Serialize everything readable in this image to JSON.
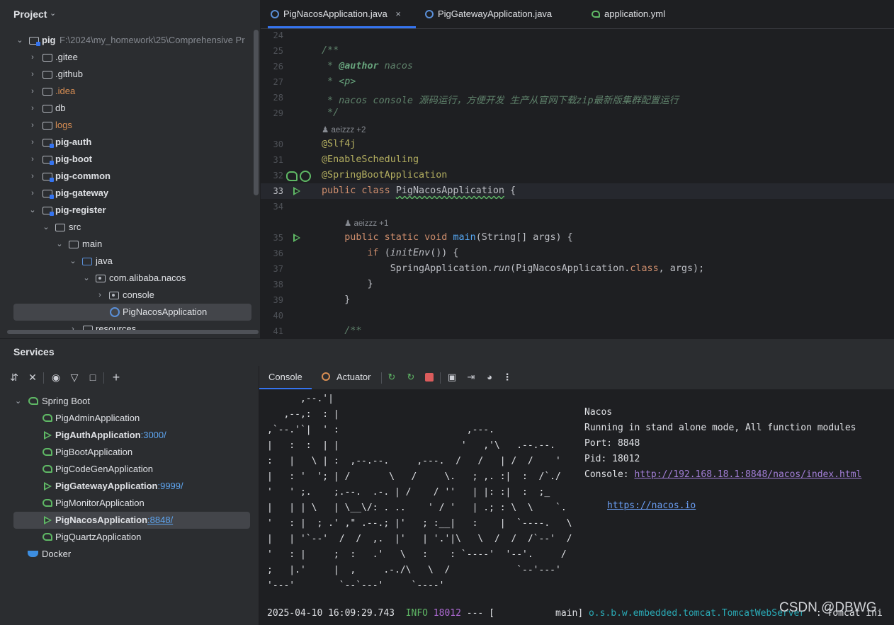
{
  "project_panel": {
    "title": "Project",
    "root": {
      "name": "pig",
      "path": "F:\\2024\\my_homework\\25\\Comprehensive Pr"
    },
    "items": [
      {
        "label": "pig",
        "type": "module",
        "bold": true
      },
      {
        "label": ".gitee",
        "type": "folder"
      },
      {
        "label": ".github",
        "type": "folder"
      },
      {
        "label": ".idea",
        "type": "folder",
        "color": "#d88e53"
      },
      {
        "label": "db",
        "type": "folder"
      },
      {
        "label": "logs",
        "type": "folder",
        "color": "#d88e53"
      },
      {
        "label": "pig-auth",
        "type": "module",
        "bold": true
      },
      {
        "label": "pig-boot",
        "type": "module",
        "bold": true
      },
      {
        "label": "pig-common",
        "type": "module",
        "bold": true
      },
      {
        "label": "pig-gateway",
        "type": "module",
        "bold": true
      },
      {
        "label": "pig-register",
        "type": "module",
        "bold": true
      },
      {
        "label": "src",
        "type": "folder"
      },
      {
        "label": "main",
        "type": "folder"
      },
      {
        "label": "java",
        "type": "folder"
      },
      {
        "label": "com.alibaba.nacos",
        "type": "package"
      },
      {
        "label": "console",
        "type": "package"
      },
      {
        "label": "PigNacosApplication",
        "type": "class"
      },
      {
        "label": "resources",
        "type": "folder"
      }
    ]
  },
  "editor": {
    "tabs": [
      {
        "label": "PigNacosApplication.java",
        "active": true,
        "close": "×"
      },
      {
        "label": "PigGatewayApplication.java",
        "active": false
      },
      {
        "label": "application.yml",
        "active": false
      }
    ],
    "line_numbers": [
      "24",
      "25",
      "26",
      "27",
      "28",
      "29",
      "30",
      "31",
      "32",
      "33",
      "34",
      "35",
      "36",
      "37",
      "38",
      "39",
      "40",
      "41"
    ],
    "hints": {
      "class_author": "aeizzz +2",
      "method_author": "aeizzz +1"
    },
    "code": {
      "l25": "/**",
      "l26_a": " * ",
      "l26_b": "@author",
      "l26_c": " nacos",
      "l27_a": " * ",
      "l27_b": "<p>",
      "l28": " * nacos console 源码运行，方便开发 生产从官网下载zip最新版集群配置运行",
      "l29": " */",
      "l30": "@Slf4j",
      "l31": "@EnableScheduling",
      "l32": "@SpringBootApplication",
      "l33_kw": "public class ",
      "l33_name": "PigNacosApplication",
      "l33_rest": " {",
      "l35_kw": "    public static void ",
      "l35_fn": "main",
      "l35_rest": "(String[] args) {",
      "l36_kw": "        if ",
      "l36_a": "(",
      "l36_it": "initEnv",
      "l36_b": "()) {",
      "l37_a": "            SpringApplication.",
      "l37_it": "run",
      "l37_b": "(PigNacosApplication.",
      "l37_kw": "class",
      "l37_c": ", args);",
      "l38": "        }",
      "l39": "    }",
      "l41": "    /**"
    }
  },
  "services": {
    "title": "Services",
    "tree": [
      {
        "label": "Spring Boot",
        "port": ""
      },
      {
        "label": "PigAdminApplication",
        "port": "",
        "running": false
      },
      {
        "label": "PigAuthApplication",
        "port": ":3000/",
        "running": true
      },
      {
        "label": "PigBootApplication",
        "port": "",
        "running": false
      },
      {
        "label": "PigCodeGenApplication",
        "port": "",
        "running": false
      },
      {
        "label": "PigGatewayApplication",
        "port": ":9999/",
        "running": true
      },
      {
        "label": "PigMonitorApplication",
        "port": "",
        "running": false
      },
      {
        "label": "PigNacosApplication",
        "port": ":8848/",
        "running": true,
        "selected": true
      },
      {
        "label": "PigQuartzApplication",
        "port": "",
        "running": false
      },
      {
        "label": "Docker",
        "port": ""
      }
    ],
    "console_tab": "Console",
    "actuator_tab": "Actuator"
  },
  "console": {
    "ascii": "      ,--.'|\n   ,--,:  : |                                           \n,`--.'`|  ' :                       ,---.               \n|   :  :  | |                      '   ,'\\   .--.--.    \n:   |   \\ | :  ,--.--.     ,---.  /   /   | /  /    '   \n|   : '  '; | /       \\   /     \\.   ; ,. :|  :  /`./   \n'   ' ;.    ;.--.  .-. | /    / ''   | |: :|  :  ;_     \n|   | | \\   | \\__\\/: . ..    ' / '   | .; : \\  \\    `.  \n'   : |  ; .' ,\" .--.; |'   ; :__|   :    |  `----.   \\ \n|   | '`--'  /  /  ,.  |'   | '.'|\\   \\  /  /  /`--'  / \n'   : |     ;  :   .'   \\   :    : `----'  '--'.     /  \n;   |.'     |  ,     .-./\\   \\  /            `--'---'   \n'---'        `--`---'     `----'                        ",
    "info": {
      "name": "Nacos",
      "mode": "Running in stand alone mode, All function modules",
      "port": "Port: 8848",
      "pid": "Pid: 18012",
      "console_label": "Console: ",
      "console_url": "http://192.168.18.1:8848/nacos/index.html",
      "site": "https://nacos.io"
    },
    "log": {
      "time": "2025-04-10 16:09:29.743  ",
      "level": "INFO",
      "pid": " 18012",
      "sep": " --- [           main] ",
      "cls": "o.s.b.w.embedded.tomcat.TomcatWebServer",
      "rest": "  : Tomcat ini"
    }
  },
  "watermark": "CSDN @DBWG"
}
